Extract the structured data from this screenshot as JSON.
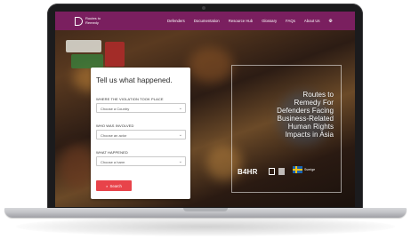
{
  "site": {
    "logo_text": "Routes to Remedy",
    "nav": [
      "Defenders",
      "Documentation",
      "Resource Hub",
      "Glossary",
      "FAQs",
      "About Us"
    ],
    "globe_icon": "globe-icon"
  },
  "form": {
    "title": "Tell us what happened.",
    "fields": [
      {
        "label": "WHERE THE VIOLATION TOOK PLACE",
        "value": "Choose a Country"
      },
      {
        "label": "WHO WAS INVOLVED",
        "value": "Choose an actor"
      },
      {
        "label": "WHAT HAPPENED",
        "value": "Choose a harm"
      }
    ],
    "search_label": "Search"
  },
  "hero": {
    "lines": [
      "Routes to",
      "Remedy For",
      "Defenders Facing",
      "Business-Related",
      "Human Rights",
      "Impacts in Asia"
    ]
  },
  "partners": {
    "bhr": "B4HR",
    "sverige": "Sverige"
  },
  "colors": {
    "navbar": "#7a1f5f",
    "button": "#e8434a"
  }
}
